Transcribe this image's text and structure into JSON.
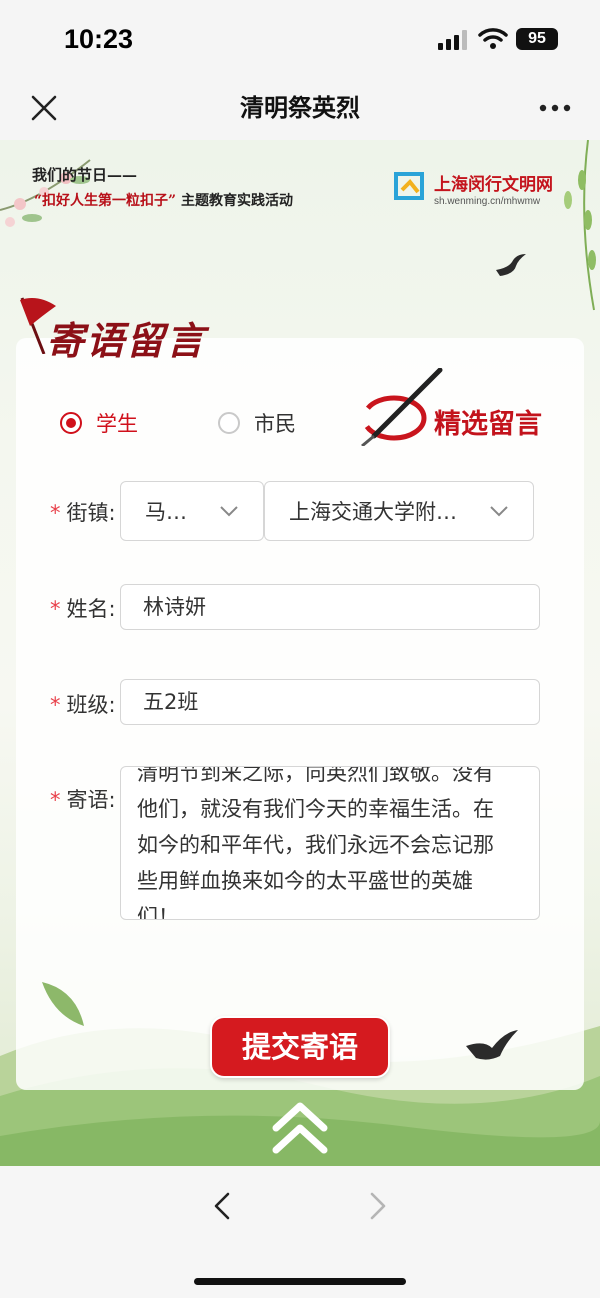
{
  "status_bar": {
    "time": "10:23",
    "battery": "95"
  },
  "nav": {
    "title": "清明祭英烈"
  },
  "banner": {
    "line1": "我们的节日——",
    "line2_highlight": "“扣好人生第一粒扣子”",
    "line2_rest": "主题教育实践活动",
    "logo_name": "上海闵行文明网",
    "logo_url": "sh.wenming.cn/mhwmw"
  },
  "form": {
    "section_title": "寄语留言",
    "radio_student": "学生",
    "radio_citizen": "市民",
    "selected_role": "学生",
    "featured_label": "精选留言",
    "street_label": "街镇:",
    "street_value": "马…",
    "school_value": "上海交通大学附…",
    "name_label": "姓名:",
    "name_value": "林诗妍",
    "class_label": "班级:",
    "class_value": "五2班",
    "message_label": "寄语:",
    "message_value": "清明节到来之际，向英烈们致敬。没有他们，就没有我们今天的幸福生活。在如今的和平年代，我们永远不会忘记那些用鲜血换来如今的太平盛世的英雄们！",
    "required_mark": "*",
    "submit_label": "提交寄语"
  },
  "colors": {
    "accent": "#d51a1f",
    "title_red": "#8c1017",
    "required": "#e8404a"
  }
}
